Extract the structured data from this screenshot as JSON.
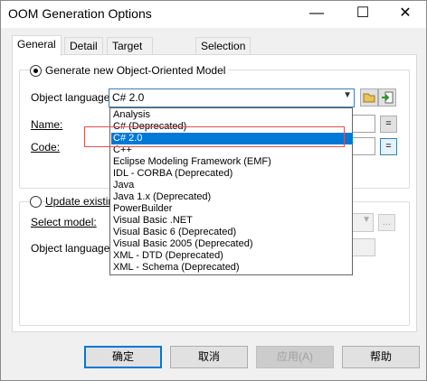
{
  "window": {
    "title": "OOM Generation Options",
    "minimize": "—",
    "maximize": "☐",
    "close": "✕"
  },
  "tabs": [
    "General",
    "Detail",
    "Target Models",
    "Selection"
  ],
  "general": {
    "generate_new_label": "Generate new Object-Oriented Model",
    "object_language_label": "Object language:",
    "object_language_value": "C# 2.0",
    "name_label": "Name:",
    "code_label": "Code:",
    "eq_label": "=",
    "update_existing_label": "Update existing",
    "select_model_label": "Select model:",
    "object_language_label2": "Object language:",
    "ellipsis": "..."
  },
  "dropdown": {
    "options": [
      "Analysis",
      "C# (Deprecated)",
      "C# 2.0",
      "C++",
      "Eclipse Modeling Framework (EMF)",
      "IDL - CORBA (Deprecated)",
      "Java",
      "Java 1.x (Deprecated)",
      "PowerBuilder",
      "Visual Basic .NET",
      "Visual Basic 6 (Deprecated)",
      "Visual Basic 2005 (Deprecated)",
      "XML - DTD (Deprecated)",
      "XML - Schema (Deprecated)"
    ],
    "selected": "C# 2.0"
  },
  "buttons": {
    "ok": "确定",
    "cancel": "取消",
    "apply": "应用(A)",
    "help": "帮助"
  },
  "colors": {
    "selection": "#0078d7",
    "highlight_box": "#e05050"
  }
}
